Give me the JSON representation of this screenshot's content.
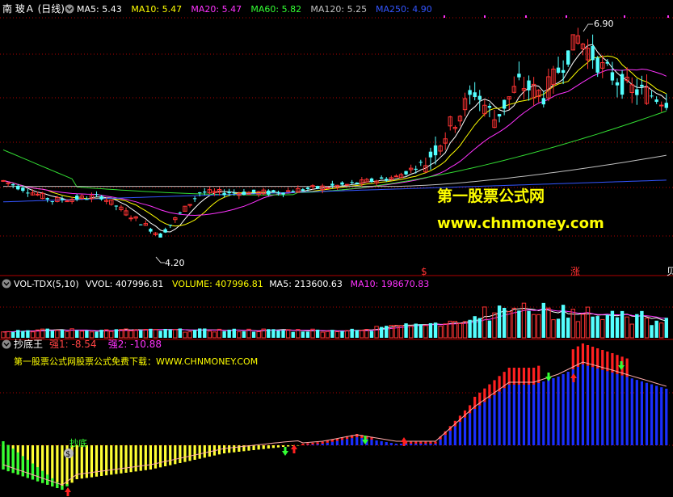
{
  "main_panel": {
    "title": "南 玻Ａ (日线)",
    "ma_labels": [
      {
        "text": "MA5: 5.43",
        "color": "#ffffff"
      },
      {
        "text": "MA10: 5.47",
        "color": "#ffff00"
      },
      {
        "text": "MA20: 5.47",
        "color": "#ff33ff"
      },
      {
        "text": "MA60: 5.82",
        "color": "#33ff33"
      },
      {
        "text": "MA120: 5.25",
        "color": "#c0c0c0"
      },
      {
        "text": "MA250: 4.90",
        "color": "#3355ff"
      }
    ],
    "high_label": "6.90",
    "low_label": "4.20",
    "watermark_title": "第一股票公式网",
    "watermark_url": "www.chnmoney.com",
    "markers": [
      "$",
      "涨",
      "贝"
    ]
  },
  "volume_panel": {
    "title": "VOL-TDX(5,10)",
    "labels": [
      {
        "text": "VVOL: 407996.81",
        "color": "#ffffff"
      },
      {
        "text": "VOLUME: 407996.81",
        "color": "#ffff00"
      },
      {
        "text": "MA5: 213600.63",
        "color": "#ffffff"
      },
      {
        "text": "MA10: 198670.83",
        "color": "#ff33ff"
      }
    ]
  },
  "indicator_panel": {
    "title": "抄底王",
    "labels": [
      {
        "text": "强1: -8.54",
        "color": "#ff4444"
      },
      {
        "text": "强2: -10.88",
        "color": "#ff33ff"
      }
    ],
    "promo_text": "第一股票公式网股票公式免费下载：WWW.CHNMONEY.COM",
    "signal_label": "抄底",
    "signal_badge": "$"
  },
  "colors": {
    "up": "#ff3333",
    "down": "#54ffff",
    "bg": "#000000",
    "grid": "#b00000",
    "ind_yellow": "#ffff33",
    "ind_green": "#33ff33",
    "ind_red": "#ff2020",
    "ind_blue": "#1a2fff"
  }
}
